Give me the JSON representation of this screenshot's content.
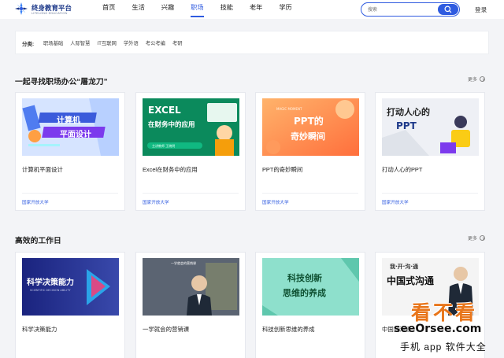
{
  "header": {
    "logo_name": "终身教育平台",
    "logo_sub": "LIFELONG EDUCATION",
    "nav": [
      {
        "label": "首页",
        "active": false
      },
      {
        "label": "生活",
        "active": false
      },
      {
        "label": "兴趣",
        "active": false
      },
      {
        "label": "职场",
        "active": true
      },
      {
        "label": "技能",
        "active": false
      },
      {
        "label": "老年",
        "active": false
      },
      {
        "label": "学历",
        "active": false
      }
    ],
    "search_placeholder": "搜索",
    "search_icon": "search-icon",
    "login_label": "登录"
  },
  "filter": {
    "label": "分类:",
    "items": [
      "职场基础",
      "人际智慧",
      "IT互联网",
      "学外语",
      "考公考编",
      "考研"
    ]
  },
  "sections": [
    {
      "title": "一起寻找职场办公“屠龙刀”",
      "more_label": "更多",
      "cards": [
        {
          "title": "计算机平面设计",
          "source": "国家开放大学",
          "thumb_text": [
            "计算机",
            "平面设计"
          ]
        },
        {
          "title": "Excel在财务中的应用",
          "source": "国家开放大学",
          "thumb_text": [
            "EXCEL",
            "在财务中的应用",
            "主讲教师 王晓明"
          ]
        },
        {
          "title": "PPT的奇妙瞬间",
          "source": "国家开放大学",
          "thumb_text": [
            "MAGIC MOMENT",
            "PPT的",
            "奇妙瞬间"
          ]
        },
        {
          "title": "打动人心的PPT",
          "source": "国家开放大学",
          "thumb_text": [
            "打动人心的",
            "PPT"
          ]
        }
      ]
    },
    {
      "title": "高效的工作日",
      "more_label": "更多",
      "cards": [
        {
          "title": "科学决策能力",
          "source": "",
          "thumb_text": [
            "科学决策能力",
            "SCIENTIFIC DECISION ABILITY"
          ]
        },
        {
          "title": "一学就会的营销课",
          "source": "",
          "thumb_text": [
            "一学就会的营销课"
          ]
        },
        {
          "title": "科技创新思维的养成",
          "source": "",
          "thumb_text": [
            "科技创新",
            "思维的养成"
          ]
        },
        {
          "title": "中国式沟通",
          "source": "",
          "thumb_text": [
            "我·开·沟·通",
            "中国式沟通"
          ]
        }
      ]
    }
  ],
  "watermark": {
    "logo": "看不看",
    "url": "seeOrsee.com",
    "tag": "手机 app 软件大全"
  },
  "colors": {
    "accent": "#2f5be0",
    "background": "#f3f4f7"
  }
}
